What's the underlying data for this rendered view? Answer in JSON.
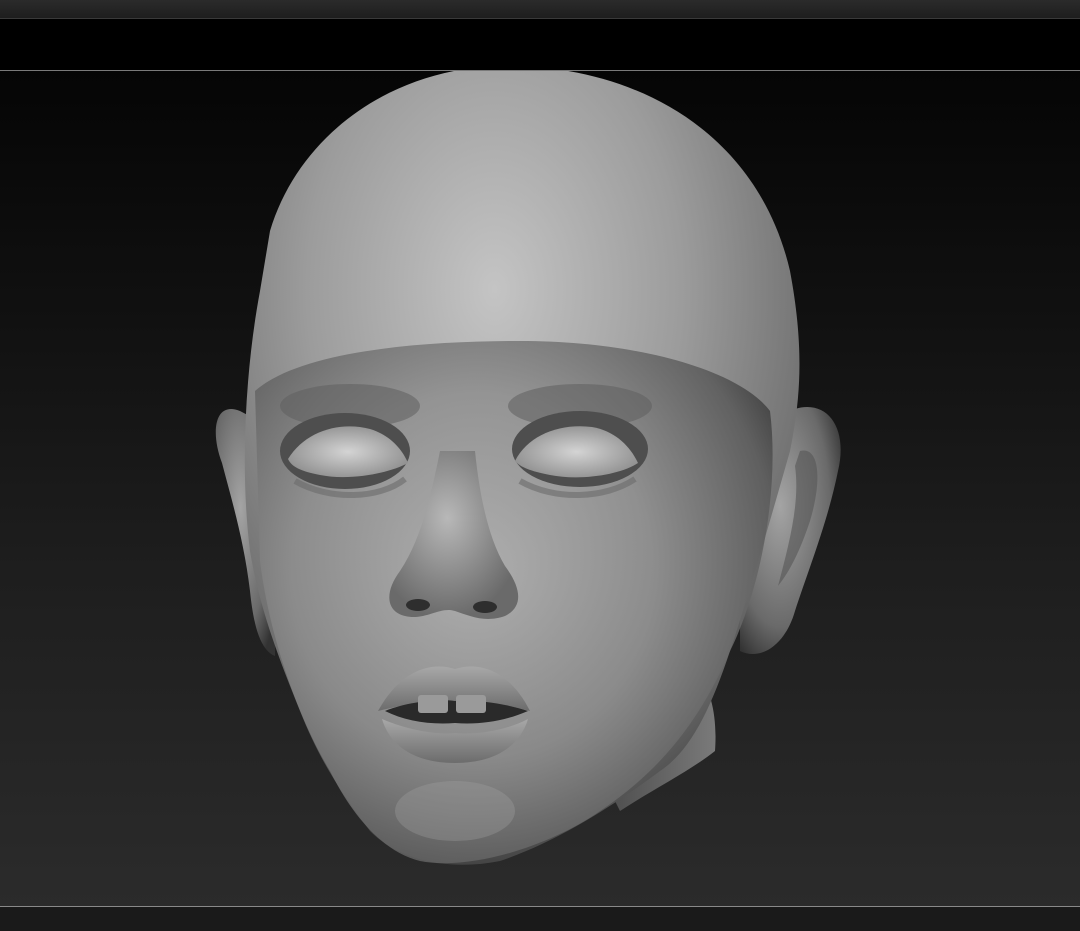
{
  "app": {
    "name": "",
    "colors": {
      "background": "#000000",
      "viewport_top": "#050505",
      "viewport_bottom": "#2b2b2b",
      "separator": "#7a7a7a",
      "sculpt_material": "#8f8f8f"
    }
  },
  "viewport": {
    "content": "sculpt-head-model"
  }
}
